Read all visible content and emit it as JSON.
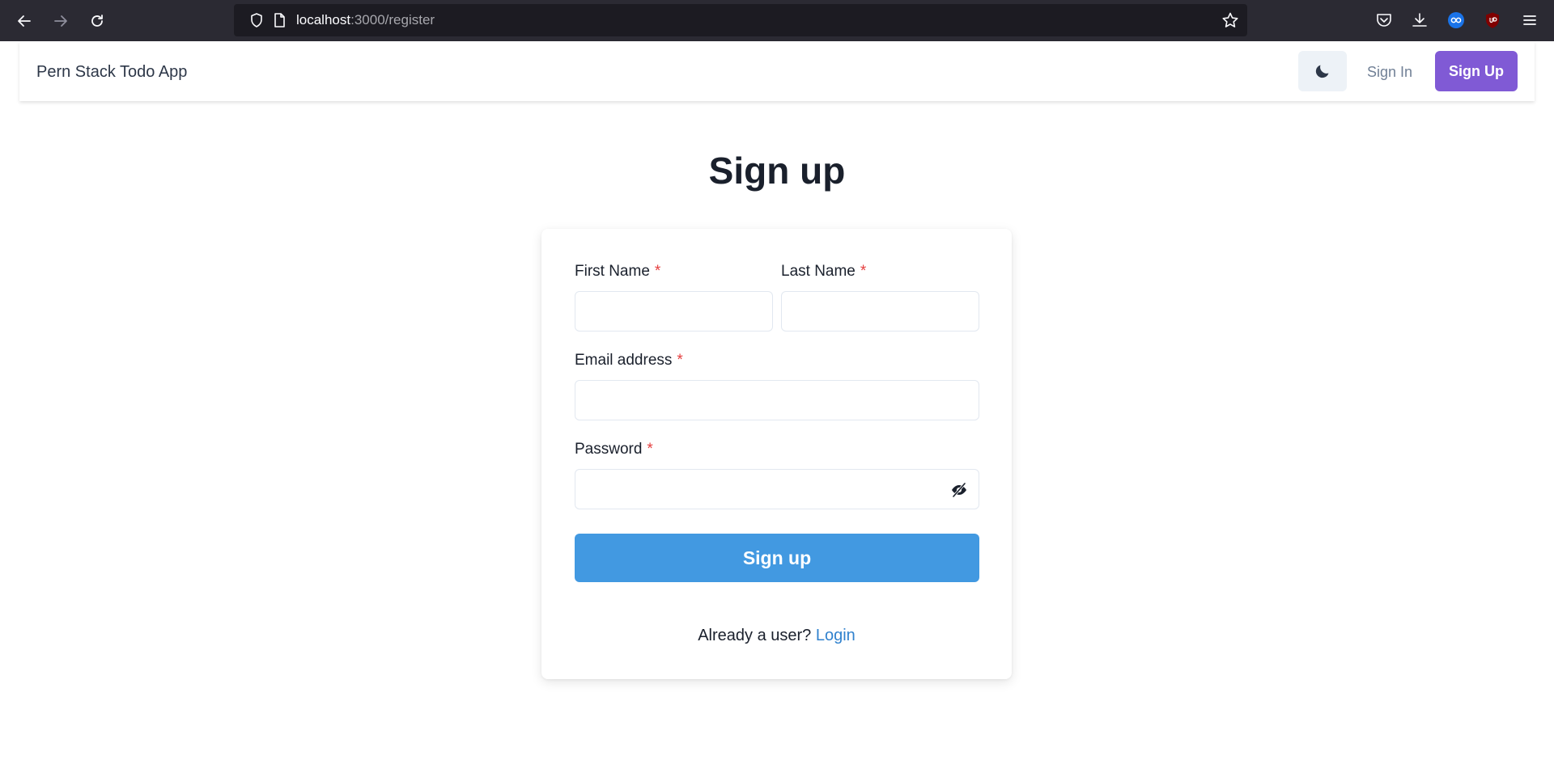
{
  "browser": {
    "url_host": "localhost",
    "url_path": ":3000/register"
  },
  "navbar": {
    "brand": "Pern Stack Todo App",
    "sign_in": "Sign In",
    "sign_up": "Sign Up"
  },
  "page": {
    "title": "Sign up"
  },
  "form": {
    "first_name_label": "First Name",
    "last_name_label": "Last Name",
    "email_label": "Email address",
    "password_label": "Password",
    "required_mark": "*",
    "first_name_value": "",
    "last_name_value": "",
    "email_value": "",
    "password_value": "",
    "submit_label": "Sign up",
    "footer_prompt": "Already a user?",
    "footer_link": "Login"
  },
  "colors": {
    "browser_bg": "#2b2a33",
    "primary_purple": "#805ad5",
    "primary_blue": "#4299e1",
    "required_red": "#e53e3e"
  }
}
